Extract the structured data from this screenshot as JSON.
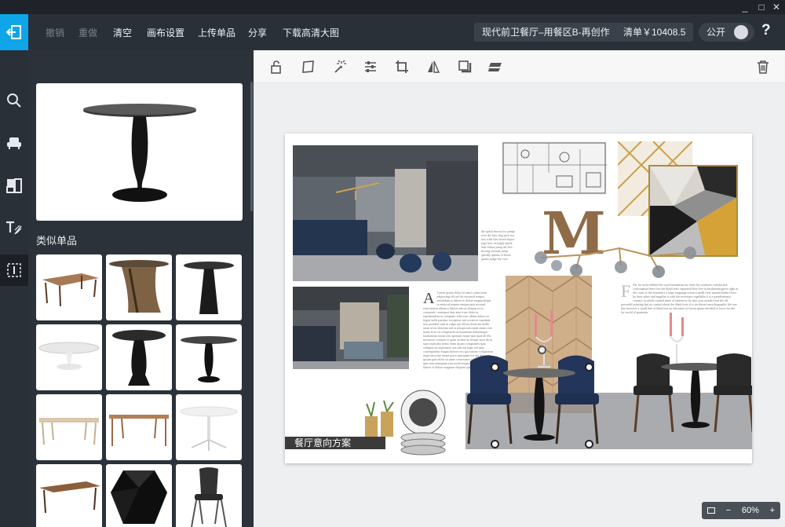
{
  "window": {
    "minimize": "_",
    "maximize": "□",
    "close": "✕"
  },
  "toolbar": {
    "undo": "撤销",
    "redo": "重做",
    "clear": "清空",
    "canvas_settings": "画布设置",
    "upload_item": "上传单品",
    "share": "分享",
    "download_hd": "下载高清大图",
    "project_title": "现代前卫餐厅–用餐区B-再创作",
    "list_total": "清单￥10408.5",
    "public_label": "公开",
    "help": "?"
  },
  "rail": {
    "items": [
      "search-icon",
      "furniture-icon",
      "material-icon",
      "text-icon",
      "layout-icon"
    ]
  },
  "panel": {
    "similar_title": "类似单品"
  },
  "canvas_tools": [
    "unlock-icon",
    "distort-icon",
    "magic-wand-icon",
    "adjust-icon",
    "crop-icon",
    "flip-icon",
    "shadow-icon",
    "layers-icon",
    "delete-icon"
  ],
  "board": {
    "caption": "餐厅意向方案",
    "logo_letter": "M"
  },
  "zoom": {
    "out": "−",
    "level": "60%",
    "in": "+"
  },
  "colors": {
    "accent": "#0ea5e9",
    "topbar": "#2a3038",
    "panel": "#2c3239"
  }
}
